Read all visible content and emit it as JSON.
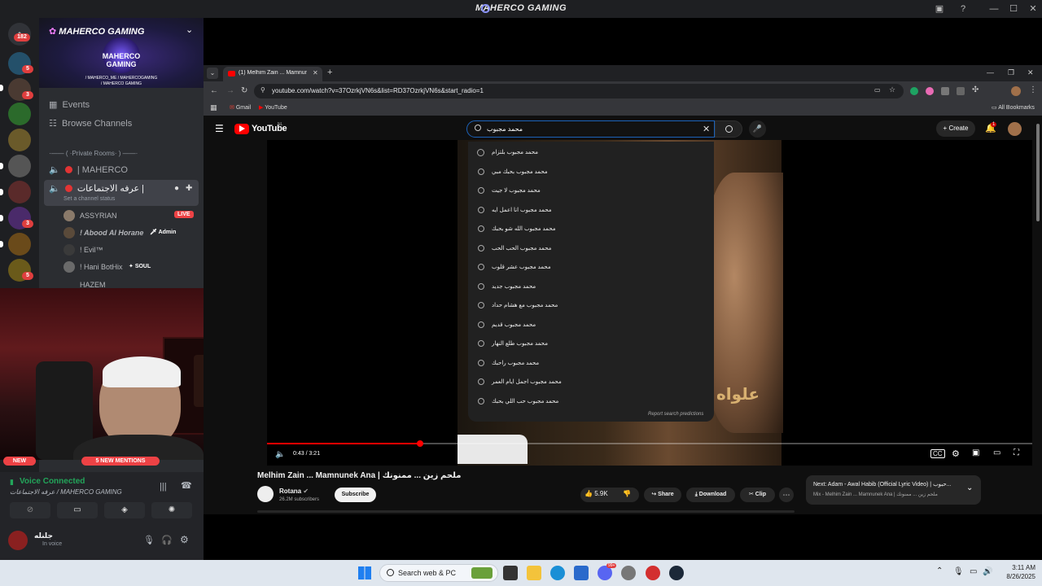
{
  "window": {
    "title": "MAHERCO GAMING"
  },
  "discord": {
    "server_rail_badges": [
      "182",
      "5",
      "3",
      "3",
      "3",
      "5"
    ],
    "server": {
      "name": "MAHERCO GAMING"
    },
    "banner": {
      "logo_text": "MAHERCO GAMING",
      "social_line1": "/ MAHERCO_ME  /  MAHERCOGAMING",
      "social_line2": "/ MAHERCO GAMING"
    },
    "nav": [
      {
        "label": "Events",
        "icon": "calendar-icon"
      },
      {
        "label": "Browse Channels",
        "icon": "browse-channels-icon"
      }
    ],
    "category": "·—— ( ·Private Rooms· ) ——·",
    "channels": [
      {
        "label": "| MAHERCO",
        "status_text": ""
      },
      {
        "label": "عرفه الاجتماعات |",
        "status_text": "Set a channel status"
      }
    ],
    "members": [
      {
        "name": "ASSYRIAN",
        "badge": "LIVE"
      },
      {
        "name": "! Abood Al Horane",
        "badge": "Admin"
      },
      {
        "name": "! Evil™",
        "badge": ""
      },
      {
        "name": "! Hani BotHix",
        "badge": "SOUL"
      },
      {
        "name": "HAZEM",
        "badge": ""
      }
    ],
    "banners": {
      "new": "NEW",
      "mentions": "5 NEW MENTIONS"
    },
    "voice": {
      "status": "Voice Connected",
      "location": "عرفه الاجتماعات / MAHERCO GAMING"
    },
    "user": {
      "name": "جلنله",
      "status": "In voice"
    }
  },
  "chrome": {
    "tab_title": "(1) Melhim Zain ... Mamnunek /",
    "url": "youtube.com/watch?v=37OzrkjVN6s&list=RD37OzrkjVN6s&start_radio=1",
    "bookmarks": [
      "Gmail",
      "YouTube"
    ],
    "all_bookmarks": "All Bookmarks"
  },
  "youtube": {
    "logo": "YouTube",
    "logo_region": "NL",
    "search_value": "محمد مجبوب",
    "create_label": "Create",
    "notifications_count": "1",
    "suggestions": [
      "محمد مجبوب بلتزام",
      "محمد مجبوب بحبك مبي",
      "محمد مجبوب لا جيت",
      "محمد مجبوب انا اعمل ايه",
      "محمد مجبوب الله شو بحبك",
      "محمد مجبوب الحب الحب",
      "محمد مجبوب عشر قلوب",
      "محمد مجبوب جديد",
      "محمد مجبوب مع هشام حداد",
      "محمد مجبوب قديم",
      "محمد مجبوب طلع النهار",
      "محمد مجبوب راحبك",
      "محمد مجبوب اجمل ايام العمر",
      "محمد مجبوب حب اللي بحبك"
    ],
    "report_predictions": "Report search predictions",
    "poster_text": "علواه",
    "player": {
      "time": "0:43 / 3:21",
      "progress": 0.2
    },
    "video_title": "Melhim Zain ... Mamnunek Ana | ملحم زين ... ممنونك",
    "channel": {
      "name": "Rotana",
      "subscribers": "26.2M subscribers",
      "subscribe_label": "Subscribe"
    },
    "actions": {
      "likes": "5.9K",
      "share": "Share",
      "download": "Download",
      "clip": "Clip"
    },
    "next": {
      "title": "Next: Adam - Awal Habib (Official Lyric Video) | حبوب...",
      "subtitle": "Mix - Melhim Zain ... Mamnunek Ana | ملحم زين ... ممنونك"
    }
  },
  "taskbar": {
    "search_placeholder": "Search web & PC",
    "time": "3:11 AM",
    "date": "8/26/2025",
    "discord_badge": "99+"
  }
}
